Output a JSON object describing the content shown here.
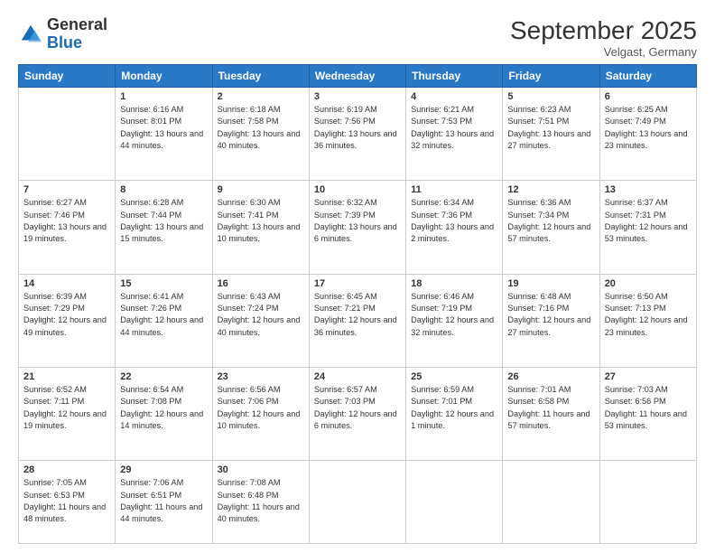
{
  "header": {
    "logo_general": "General",
    "logo_blue": "Blue",
    "month_title": "September 2025",
    "location": "Velgast, Germany"
  },
  "weekdays": [
    "Sunday",
    "Monday",
    "Tuesday",
    "Wednesday",
    "Thursday",
    "Friday",
    "Saturday"
  ],
  "weeks": [
    [
      {
        "day": "",
        "sunrise": "",
        "sunset": "",
        "daylight": ""
      },
      {
        "day": "1",
        "sunrise": "Sunrise: 6:16 AM",
        "sunset": "Sunset: 8:01 PM",
        "daylight": "Daylight: 13 hours and 44 minutes."
      },
      {
        "day": "2",
        "sunrise": "Sunrise: 6:18 AM",
        "sunset": "Sunset: 7:58 PM",
        "daylight": "Daylight: 13 hours and 40 minutes."
      },
      {
        "day": "3",
        "sunrise": "Sunrise: 6:19 AM",
        "sunset": "Sunset: 7:56 PM",
        "daylight": "Daylight: 13 hours and 36 minutes."
      },
      {
        "day": "4",
        "sunrise": "Sunrise: 6:21 AM",
        "sunset": "Sunset: 7:53 PM",
        "daylight": "Daylight: 13 hours and 32 minutes."
      },
      {
        "day": "5",
        "sunrise": "Sunrise: 6:23 AM",
        "sunset": "Sunset: 7:51 PM",
        "daylight": "Daylight: 13 hours and 27 minutes."
      },
      {
        "day": "6",
        "sunrise": "Sunrise: 6:25 AM",
        "sunset": "Sunset: 7:49 PM",
        "daylight": "Daylight: 13 hours and 23 minutes."
      }
    ],
    [
      {
        "day": "7",
        "sunrise": "Sunrise: 6:27 AM",
        "sunset": "Sunset: 7:46 PM",
        "daylight": "Daylight: 13 hours and 19 minutes."
      },
      {
        "day": "8",
        "sunrise": "Sunrise: 6:28 AM",
        "sunset": "Sunset: 7:44 PM",
        "daylight": "Daylight: 13 hours and 15 minutes."
      },
      {
        "day": "9",
        "sunrise": "Sunrise: 6:30 AM",
        "sunset": "Sunset: 7:41 PM",
        "daylight": "Daylight: 13 hours and 10 minutes."
      },
      {
        "day": "10",
        "sunrise": "Sunrise: 6:32 AM",
        "sunset": "Sunset: 7:39 PM",
        "daylight": "Daylight: 13 hours and 6 minutes."
      },
      {
        "day": "11",
        "sunrise": "Sunrise: 6:34 AM",
        "sunset": "Sunset: 7:36 PM",
        "daylight": "Daylight: 13 hours and 2 minutes."
      },
      {
        "day": "12",
        "sunrise": "Sunrise: 6:36 AM",
        "sunset": "Sunset: 7:34 PM",
        "daylight": "Daylight: 12 hours and 57 minutes."
      },
      {
        "day": "13",
        "sunrise": "Sunrise: 6:37 AM",
        "sunset": "Sunset: 7:31 PM",
        "daylight": "Daylight: 12 hours and 53 minutes."
      }
    ],
    [
      {
        "day": "14",
        "sunrise": "Sunrise: 6:39 AM",
        "sunset": "Sunset: 7:29 PM",
        "daylight": "Daylight: 12 hours and 49 minutes."
      },
      {
        "day": "15",
        "sunrise": "Sunrise: 6:41 AM",
        "sunset": "Sunset: 7:26 PM",
        "daylight": "Daylight: 12 hours and 44 minutes."
      },
      {
        "day": "16",
        "sunrise": "Sunrise: 6:43 AM",
        "sunset": "Sunset: 7:24 PM",
        "daylight": "Daylight: 12 hours and 40 minutes."
      },
      {
        "day": "17",
        "sunrise": "Sunrise: 6:45 AM",
        "sunset": "Sunset: 7:21 PM",
        "daylight": "Daylight: 12 hours and 36 minutes."
      },
      {
        "day": "18",
        "sunrise": "Sunrise: 6:46 AM",
        "sunset": "Sunset: 7:19 PM",
        "daylight": "Daylight: 12 hours and 32 minutes."
      },
      {
        "day": "19",
        "sunrise": "Sunrise: 6:48 AM",
        "sunset": "Sunset: 7:16 PM",
        "daylight": "Daylight: 12 hours and 27 minutes."
      },
      {
        "day": "20",
        "sunrise": "Sunrise: 6:50 AM",
        "sunset": "Sunset: 7:13 PM",
        "daylight": "Daylight: 12 hours and 23 minutes."
      }
    ],
    [
      {
        "day": "21",
        "sunrise": "Sunrise: 6:52 AM",
        "sunset": "Sunset: 7:11 PM",
        "daylight": "Daylight: 12 hours and 19 minutes."
      },
      {
        "day": "22",
        "sunrise": "Sunrise: 6:54 AM",
        "sunset": "Sunset: 7:08 PM",
        "daylight": "Daylight: 12 hours and 14 minutes."
      },
      {
        "day": "23",
        "sunrise": "Sunrise: 6:56 AM",
        "sunset": "Sunset: 7:06 PM",
        "daylight": "Daylight: 12 hours and 10 minutes."
      },
      {
        "day": "24",
        "sunrise": "Sunrise: 6:57 AM",
        "sunset": "Sunset: 7:03 PM",
        "daylight": "Daylight: 12 hours and 6 minutes."
      },
      {
        "day": "25",
        "sunrise": "Sunrise: 6:59 AM",
        "sunset": "Sunset: 7:01 PM",
        "daylight": "Daylight: 12 hours and 1 minute."
      },
      {
        "day": "26",
        "sunrise": "Sunrise: 7:01 AM",
        "sunset": "Sunset: 6:58 PM",
        "daylight": "Daylight: 11 hours and 57 minutes."
      },
      {
        "day": "27",
        "sunrise": "Sunrise: 7:03 AM",
        "sunset": "Sunset: 6:56 PM",
        "daylight": "Daylight: 11 hours and 53 minutes."
      }
    ],
    [
      {
        "day": "28",
        "sunrise": "Sunrise: 7:05 AM",
        "sunset": "Sunset: 6:53 PM",
        "daylight": "Daylight: 11 hours and 48 minutes."
      },
      {
        "day": "29",
        "sunrise": "Sunrise: 7:06 AM",
        "sunset": "Sunset: 6:51 PM",
        "daylight": "Daylight: 11 hours and 44 minutes."
      },
      {
        "day": "30",
        "sunrise": "Sunrise: 7:08 AM",
        "sunset": "Sunset: 6:48 PM",
        "daylight": "Daylight: 11 hours and 40 minutes."
      },
      {
        "day": "",
        "sunrise": "",
        "sunset": "",
        "daylight": ""
      },
      {
        "day": "",
        "sunrise": "",
        "sunset": "",
        "daylight": ""
      },
      {
        "day": "",
        "sunrise": "",
        "sunset": "",
        "daylight": ""
      },
      {
        "day": "",
        "sunrise": "",
        "sunset": "",
        "daylight": ""
      }
    ]
  ]
}
